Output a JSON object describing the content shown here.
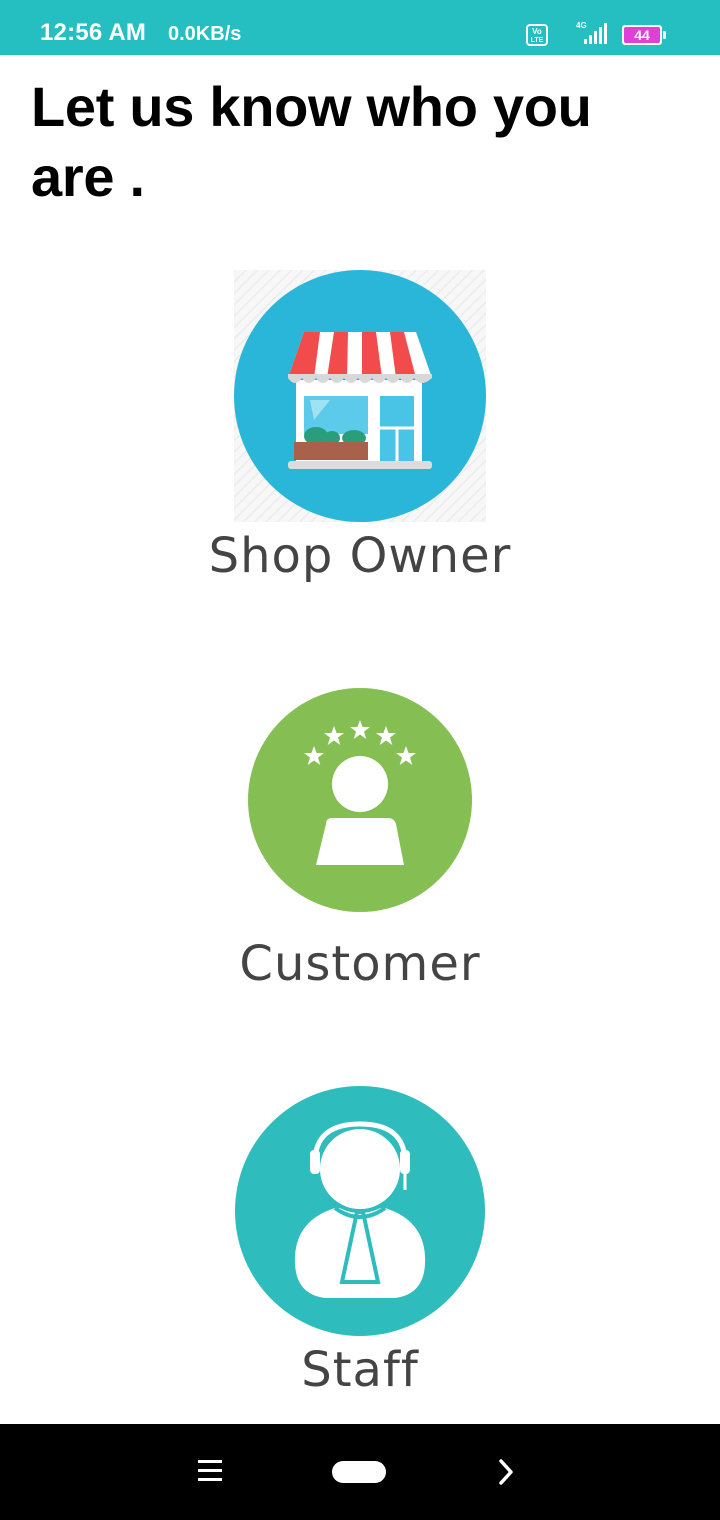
{
  "status_bar": {
    "time": "12:56 AM",
    "net_speed": "0.0KB/s",
    "volte_label": "Vo LTE",
    "network_type": "4G",
    "battery_level": "44",
    "icons": [
      "volte-icon",
      "signal-icon",
      "battery-icon"
    ],
    "bg_color": "#25bec1"
  },
  "page": {
    "title": "Let us know who you are ."
  },
  "roles": [
    {
      "label": "Shop Owner",
      "icon": "shop-icon",
      "color": "#29b6d8"
    },
    {
      "label": "Customer",
      "icon": "customer-icon",
      "color": "#85bf54"
    },
    {
      "label": "Staff",
      "icon": "staff-icon",
      "color": "#2fbcbc"
    }
  ],
  "nav_bar": {
    "icons": [
      "menu-icon",
      "home-icon",
      "back-icon"
    ]
  }
}
